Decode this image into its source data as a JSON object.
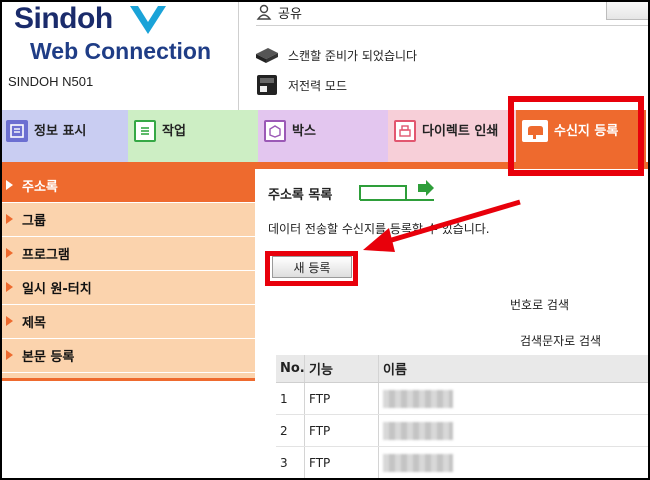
{
  "header": {
    "logo_brand": "Sindoh",
    "logo_product": "Web Connection",
    "model": "SINDOH N501",
    "user_label": "공유",
    "status_scan": "스캔할 준비가 되었습니다",
    "status_power": "저전력 모드"
  },
  "tabs": [
    {
      "label": "정보 표시",
      "icon": "info-icon"
    },
    {
      "label": "작업",
      "icon": "job-icon"
    },
    {
      "label": "박스",
      "icon": "box-icon"
    },
    {
      "label": "다이렉트 인쇄",
      "icon": "direct-print-icon"
    },
    {
      "label": "수신지 등록",
      "icon": "destination-icon",
      "active": true
    }
  ],
  "sidebar": {
    "items": [
      {
        "label": "주소록",
        "active": true
      },
      {
        "label": "그룹"
      },
      {
        "label": "프로그램"
      },
      {
        "label": "일시 원-터치"
      },
      {
        "label": "제목"
      },
      {
        "label": "본문 등록"
      }
    ]
  },
  "main": {
    "title": "주소록 목록",
    "description": "데이터 전송할 수신지를 등록할 수 있습니다.",
    "new_button": "새 등록",
    "search_by_number": "번호로 검색",
    "search_by_string": "검색문자로 검색"
  },
  "table": {
    "headers": [
      "No.",
      "기능",
      "이름"
    ],
    "rows": [
      {
        "no": "1",
        "function": "FTP"
      },
      {
        "no": "2",
        "function": "FTP"
      },
      {
        "no": "3",
        "function": "FTP"
      }
    ]
  },
  "colors": {
    "accent": "#ee6a2e",
    "highlight": "#e8000b",
    "sidebar_bg": "#fbd3ad"
  }
}
